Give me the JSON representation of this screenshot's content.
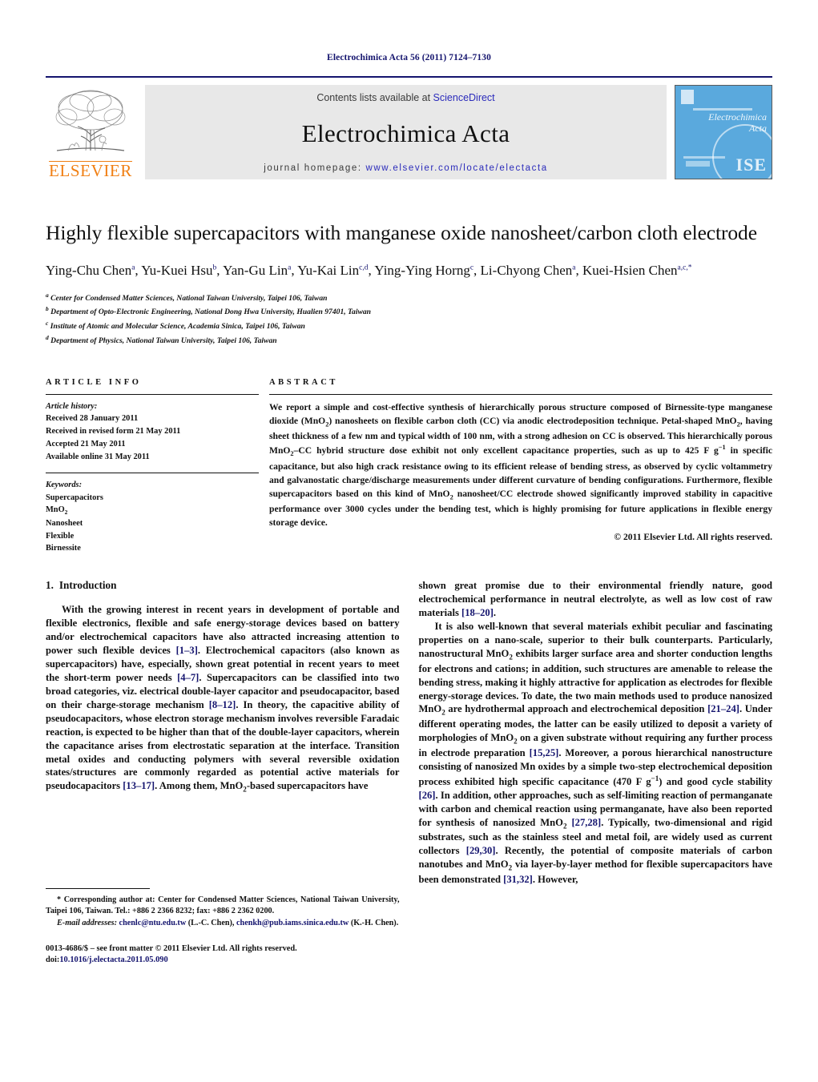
{
  "running_head": "Electrochimica Acta 56 (2011) 7124–7130",
  "masthead": {
    "contents_prefix": "Contents lists available at ",
    "sciencedirect": "ScienceDirect",
    "journal_title": "Electrochimica Acta",
    "homepage_label": "journal homepage: ",
    "homepage_url": "www.elsevier.com/locate/electacta",
    "publisher_wordmark": "ELSEVIER",
    "cover_title_line1": "Electrochimica",
    "cover_title_line2": "Acta",
    "cover_society_mark": "ISE",
    "accent_blue": "#14146e",
    "link_blue": "#2b2bbb",
    "elsevier_orange": "#f07f13",
    "cover_blue": "#5aa9dd"
  },
  "article": {
    "title": "Highly flexible supercapacitors with manganese oxide nanosheet/carbon cloth electrode",
    "authors_line1": "Ying-Chu Chen a, Yu-Kuei Hsu b, Yan-Gu Lin a, Yu-Kai Lin c,d, Ying-Ying Horng c, Li-Chyong Chen a,",
    "authors_line2": "Kuei-Hsien Chen a,c,*",
    "authors_html": "Ying-Chu Chen<sup>a</sup>, Yu-Kuei Hsu<sup>b</sup>, Yan-Gu Lin<sup>a</sup>, Yu-Kai Lin<sup>c,d</sup>, Ying-Ying Horng<sup>c</sup>, Li-Chyong Chen<sup>a</sup>, Kuei-Hsien Chen<sup>a,c,*</sup>",
    "affiliations": [
      {
        "marker": "a",
        "text": "Center for Condensed Matter Sciences, National Taiwan University, Taipei 106, Taiwan"
      },
      {
        "marker": "b",
        "text": "Department of Opto-Electronic Engineering, National Dong Hwa University, Hualien 97401, Taiwan"
      },
      {
        "marker": "c",
        "text": "Institute of Atomic and Molecular Science, Academia Sinica, Taipei 106, Taiwan"
      },
      {
        "marker": "d",
        "text": "Department of Physics, National Taiwan University, Taipei 106, Taiwan"
      }
    ]
  },
  "article_info": {
    "heading": "ARTICLE INFO",
    "history_label": "Article history:",
    "history": [
      "Received 28 January 2011",
      "Received in revised form 21 May 2011",
      "Accepted 21 May 2011",
      "Available online 31 May 2011"
    ],
    "keywords_label": "Keywords:",
    "keywords": [
      "Supercapacitors",
      "MnO2",
      "Nanosheet",
      "Flexible",
      "Birnessite"
    ]
  },
  "abstract": {
    "heading": "ABSTRACT",
    "text_html": "We report a simple and cost-effective synthesis of hierarchically porous structure composed of Birnessite-type manganese dioxide (MnO<sub>2</sub>) nanosheets on flexible carbon cloth (CC) via anodic electrodeposition technique. Petal-shaped MnO<sub>2</sub>, having sheet thickness of a few nm and typical width of 100 nm, with a strong adhesion on CC is observed. This hierarchically porous MnO<sub>2</sub>&ndash;CC hybrid structure dose exhibit not only excellent capacitance properties, such as up to 425 F g<sup>&minus;1</sup> in specific capacitance, but also high crack resistance owing to its efficient release of bending stress, as observed by cyclic voltammetry and galvanostatic charge/discharge measurements under different curvature of bending configurations. Furthermore, flexible supercapacitors based on this kind of MnO<sub>2</sub> nanosheet/CC electrode showed significantly improved stability in capacitive performance over 3000 cycles under the bending test, which is highly promising for future applications in flexible energy storage device.",
    "copyright": "© 2011 Elsevier Ltd. All rights reserved."
  },
  "introduction": {
    "number": "1.",
    "title": "Introduction",
    "left_para_1_html": "With the growing interest in recent years in development of portable and flexible electronics, flexible and safe energy-storage devices based on battery and/or electrochemical capacitors have also attracted increasing attention to power such flexible devices <span class=\"ref\">[1&ndash;3]</span>. Electrochemical capacitors (also known as supercapacitors) have, especially, shown great potential in recent years to meet the short-term power needs <span class=\"ref\">[4&ndash;7]</span>. Supercapacitors can be classified into two broad categories, viz. electrical double-layer capacitor and pseudocapacitor, based on their charge-storage mechanism <span class=\"ref\">[8&ndash;12]</span>. In theory, the capacitive ability of pseudocapacitors, whose electron storage mechanism involves reversible Faradaic reaction, is expected to be higher than that of the double-layer capacitors, wherein the capacitance arises from electrostatic separation at the interface. Transition metal oxides and conducting polymers with several reversible oxidation states/structures are commonly regarded as potential active materials for pseudocapacitors <span class=\"ref\">[13&ndash;17]</span>. Among them, MnO<sub>2</sub>-based supercapacitors have",
    "right_para_1_html": "shown great promise due to their environmental friendly nature, good electrochemical performance in neutral electrolyte, as well as low cost of raw materials <span class=\"ref\">[18&ndash;20]</span>.",
    "right_para_2_html": "It is also well-known that several materials exhibit peculiar and fascinating properties on a nano-scale, superior to their bulk counterparts. Particularly, nanostructural MnO<sub>2</sub> exhibits larger surface area and shorter conduction lengths for electrons and cations; in addition, such structures are amenable to release the bending stress, making it highly attractive for application as electrodes for flexible energy-storage devices. To date, the two main methods used to produce nanosized MnO<sub>2</sub> are hydrothermal approach and electrochemical deposition <span class=\"ref\">[21&ndash;24]</span>. Under different operating modes, the latter can be easily utilized to deposit a variety of morphologies of MnO<sub>2</sub> on a given substrate without requiring any further process in electrode preparation <span class=\"ref\">[15,25]</span>. Moreover, a porous hierarchical nanostructure consisting of nanosized Mn oxides by a simple two-step electrochemical deposition process exhibited high specific capacitance (470 F g<sup>&minus;1</sup>) and good cycle stability <span class=\"ref\">[26]</span>. In addition, other approaches, such as self-limiting reaction of permanganate with carbon and chemical reaction using permanganate, have also been reported for synthesis of nanosized MnO<sub>2</sub> <span class=\"ref\">[27,28]</span>. Typically, two-dimensional and rigid substrates, such as the stainless steel and metal foil, are widely used as current collectors <span class=\"ref\">[29,30]</span>. Recently, the potential of composite materials of carbon nanotubes and MnO<sub>2</sub> via layer-by-layer method for flexible supercapacitors have been demonstrated <span class=\"ref\">[31,32]</span>. However,"
  },
  "footnotes": {
    "corresponding_html": "* Corresponding author at: Center for Condensed Matter Sciences, National Taiwan University, Taipei 106, Taiwan. Tel.: +886 2 2366 8232; fax: +886 2 2362 0200.",
    "email_html": "<em>E-mail addresses:</em> <span class=\"link\">chenlc@ntu.edu.tw</span> (L.-C. Chen), <span class=\"link\">chenkh@pub.iams.sinica.edu.tw</span> (K.-H. Chen).",
    "frontmatter_html": "0013-4686/$ &ndash; see front matter &copy; 2011 Elsevier Ltd. All rights reserved.<br>doi:<span class=\"link\">10.1016/j.electacta.2011.05.090</span>"
  }
}
